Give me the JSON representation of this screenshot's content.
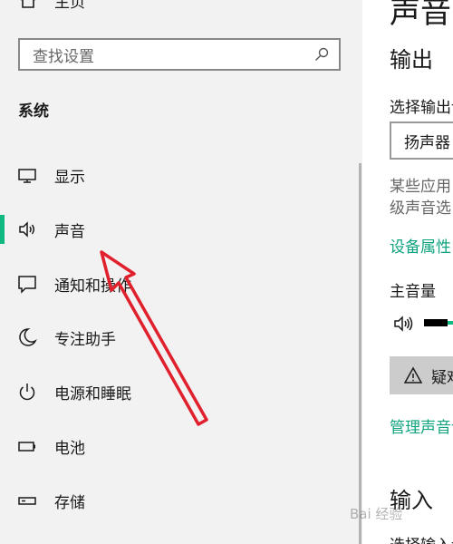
{
  "sidebar": {
    "home_label": "主页",
    "search_placeholder": "查找设置",
    "section_title": "系统",
    "items": [
      {
        "label": "显示",
        "icon": "monitor-icon"
      },
      {
        "label": "声音",
        "icon": "speaker-icon",
        "selected": true
      },
      {
        "label": "通知和操作",
        "icon": "notification-icon"
      },
      {
        "label": "专注助手",
        "icon": "moon-icon"
      },
      {
        "label": "电源和睡眠",
        "icon": "power-icon"
      },
      {
        "label": "电池",
        "icon": "battery-icon"
      },
      {
        "label": "存储",
        "icon": "storage-icon"
      }
    ]
  },
  "main": {
    "title": "声音",
    "output_heading": "输出",
    "choose_output_label": "选择输出设备",
    "output_device": "扬声器",
    "hint_line1": "某些应用",
    "hint_line2": "级声音选",
    "device_properties_link": "设备属性",
    "master_volume_label": "主音量",
    "master_volume_fraction": 0.5,
    "troubleshoot_button": "疑难解答",
    "manage_devices_link": "管理声音设备",
    "input_heading": "输入",
    "choose_input_label": "选择输入设备"
  },
  "watermark": "Bai 经验",
  "colors": {
    "accent": "#10b981",
    "link": "#10a37f",
    "annotation_arrow": "#e0202c"
  }
}
